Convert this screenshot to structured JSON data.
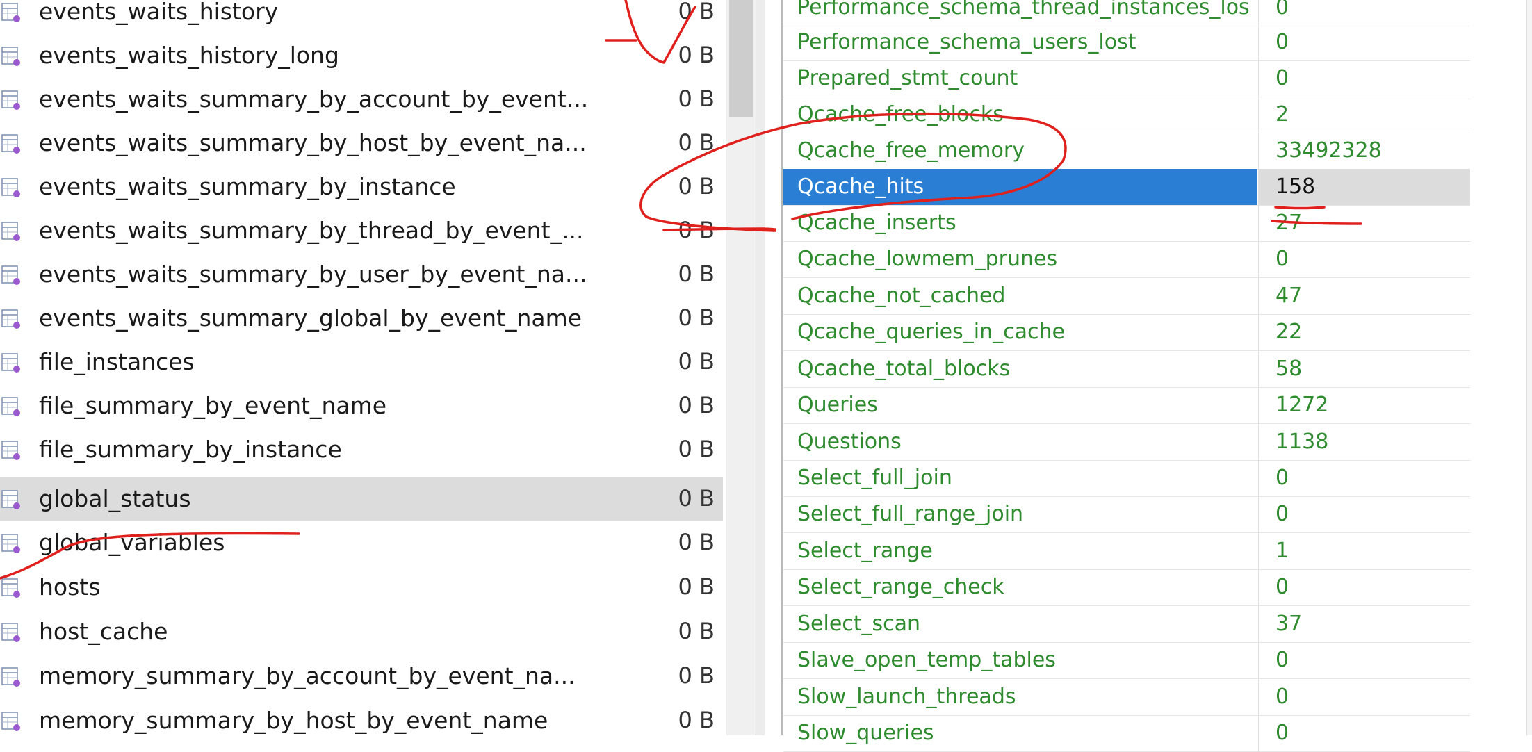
{
  "table_list": {
    "selected_index": 11,
    "items": [
      {
        "name": "events_waits_history",
        "size": "0 B"
      },
      {
        "name": "events_waits_history_long",
        "size": "0 B"
      },
      {
        "name": "events_waits_summary_by_account_by_event...",
        "size": "0 B"
      },
      {
        "name": "events_waits_summary_by_host_by_event_na...",
        "size": "0 B"
      },
      {
        "name": "events_waits_summary_by_instance",
        "size": "0 B"
      },
      {
        "name": "events_waits_summary_by_thread_by_event_...",
        "size": "0 B"
      },
      {
        "name": "events_waits_summary_by_user_by_event_na...",
        "size": "0 B"
      },
      {
        "name": "events_waits_summary_global_by_event_name",
        "size": "0 B"
      },
      {
        "name": "file_instances",
        "size": "0 B"
      },
      {
        "name": "file_summary_by_event_name",
        "size": "0 B"
      },
      {
        "name": "file_summary_by_instance",
        "size": "0 B"
      },
      {
        "name": "global_status",
        "size": "0 B"
      },
      {
        "name": "global_variables",
        "size": "0 B"
      },
      {
        "name": "hosts",
        "size": "0 B"
      },
      {
        "name": "host_cache",
        "size": "0 B"
      },
      {
        "name": "memory_summary_by_account_by_event_na...",
        "size": "0 B"
      },
      {
        "name": "memory_summary_by_host_by_event_name",
        "size": "0 B"
      }
    ]
  },
  "status_grid": {
    "selected_index": 5,
    "rows": [
      {
        "name": "Performance_schema_thread_instances_lost",
        "value": "0"
      },
      {
        "name": "Performance_schema_users_lost",
        "value": "0"
      },
      {
        "name": "Prepared_stmt_count",
        "value": "0"
      },
      {
        "name": "Qcache_free_blocks",
        "value": "2"
      },
      {
        "name": "Qcache_free_memory",
        "value": "33492328"
      },
      {
        "name": "Qcache_hits",
        "value": "158"
      },
      {
        "name": "Qcache_inserts",
        "value": "27"
      },
      {
        "name": "Qcache_lowmem_prunes",
        "value": "0"
      },
      {
        "name": "Qcache_not_cached",
        "value": "47"
      },
      {
        "name": "Qcache_queries_in_cache",
        "value": "22"
      },
      {
        "name": "Qcache_total_blocks",
        "value": "58"
      },
      {
        "name": "Queries",
        "value": "1272"
      },
      {
        "name": "Questions",
        "value": "1138"
      },
      {
        "name": "Select_full_join",
        "value": "0"
      },
      {
        "name": "Select_full_range_join",
        "value": "0"
      },
      {
        "name": "Select_range",
        "value": "1"
      },
      {
        "name": "Select_range_check",
        "value": "0"
      },
      {
        "name": "Select_scan",
        "value": "37"
      },
      {
        "name": "Slave_open_temp_tables",
        "value": "0"
      },
      {
        "name": "Slow_launch_threads",
        "value": "0"
      },
      {
        "name": "Slow_queries",
        "value": "0"
      }
    ]
  },
  "colors": {
    "grid_text": "#2e8b2e",
    "selection_blue": "#2a7fd4",
    "row_highlight": "#dcdcdc",
    "annotation_ink": "#e0201c"
  }
}
